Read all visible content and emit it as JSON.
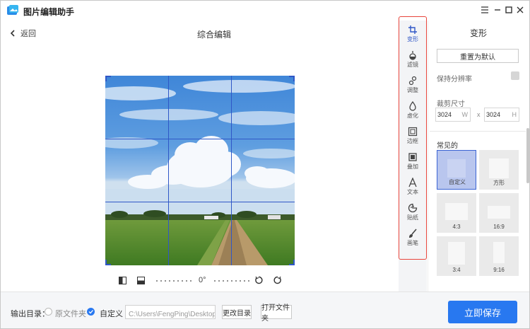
{
  "app": {
    "title": "图片编辑助手"
  },
  "window": {
    "minimize": "—",
    "menu": "☰",
    "maximize": "□",
    "close": "✕"
  },
  "header": {
    "back_label": "返回",
    "page_title": "综合编辑"
  },
  "canvas": {
    "rotation_label": "0°"
  },
  "tools": [
    {
      "label": "变形",
      "icon": "crop-icon",
      "active": true
    },
    {
      "label": "滤镜",
      "icon": "filter-icon",
      "active": false
    },
    {
      "label": "调整",
      "icon": "adjust-icon",
      "active": false
    },
    {
      "label": "虚化",
      "icon": "blur-drop-icon",
      "active": false
    },
    {
      "label": "边框",
      "icon": "border-icon",
      "active": false
    },
    {
      "label": "叠加",
      "icon": "overlay-icon",
      "active": false
    },
    {
      "label": "文本",
      "icon": "text-icon",
      "active": false
    },
    {
      "label": "贴纸",
      "icon": "sticker-icon",
      "active": false
    },
    {
      "label": "画笔",
      "icon": "brush-icon",
      "active": false
    }
  ],
  "panel": {
    "title": "变形",
    "reset_label": "重置为默认",
    "keep_resolution_label": "保持分辨率",
    "crop_size_label": "裁剪尺寸",
    "width_value": "3024",
    "width_unit": "W",
    "height_value": "3024",
    "height_unit": "H",
    "times": "x",
    "common_label": "常见的",
    "ratios": [
      {
        "label": "自定义",
        "selected": true
      },
      {
        "label": "方形",
        "selected": false
      },
      {
        "label": "4:3",
        "selected": false
      },
      {
        "label": "16:9",
        "selected": false
      },
      {
        "label": "3:4",
        "selected": false
      },
      {
        "label": "9:16",
        "selected": false
      }
    ]
  },
  "footer": {
    "output_label": "输出目录：",
    "option_original": "原文件夹",
    "option_custom": "自定义",
    "path_value": "C:\\Users\\FengPing\\Desktop\\图片",
    "change_dir_label": "更改目录",
    "open_folder_label": "打开文件夹",
    "save_label": "立即保存"
  },
  "colors": {
    "accent": "#2878f0",
    "highlight": "#e8453c",
    "grid": "#2f57c7"
  }
}
